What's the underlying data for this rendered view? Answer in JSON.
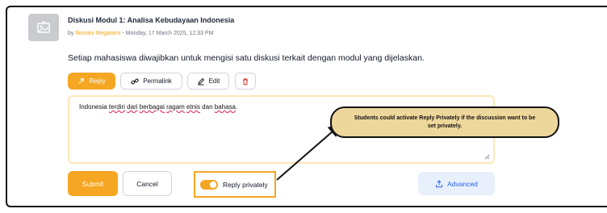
{
  "post": {
    "title": "Diskusi Modul 1: Analisa Kebudayaan Indonesia",
    "by": "by",
    "author": "Noviani Megatami",
    "date": " - Monday, 17 March 2025, 12:33 PM",
    "body": "Setiap mahasiswa diwajibkan untuk mengisi satu diskusi terkait dengan modul yang dijelaskan."
  },
  "actions": {
    "reply": "Reply",
    "permalink": "Permalink",
    "edit": "Edit"
  },
  "reply_box": {
    "text_pre": "Indonesia ",
    "text_w1": "terdiri",
    "text_s1": " ",
    "text_w2": "dari",
    "text_s2": " ",
    "text_w3": "berbagai",
    "text_s3": " ",
    "text_w4": "ragam",
    "text_s4": " ",
    "text_w5": "etnis",
    "text_s5": " dan ",
    "text_w6": "bahasa",
    "text_post": "."
  },
  "form": {
    "submit": "Submit",
    "cancel": "Cancel",
    "reply_privately": "Reply privately",
    "advanced": "Advanced"
  },
  "callout": {
    "text": "Students could activate Reply Privately if the discussion want to be set privately."
  },
  "colors": {
    "accent": "#f5a623",
    "callout_bg": "#eed79b",
    "advanced_bg": "#e8f0fb"
  }
}
